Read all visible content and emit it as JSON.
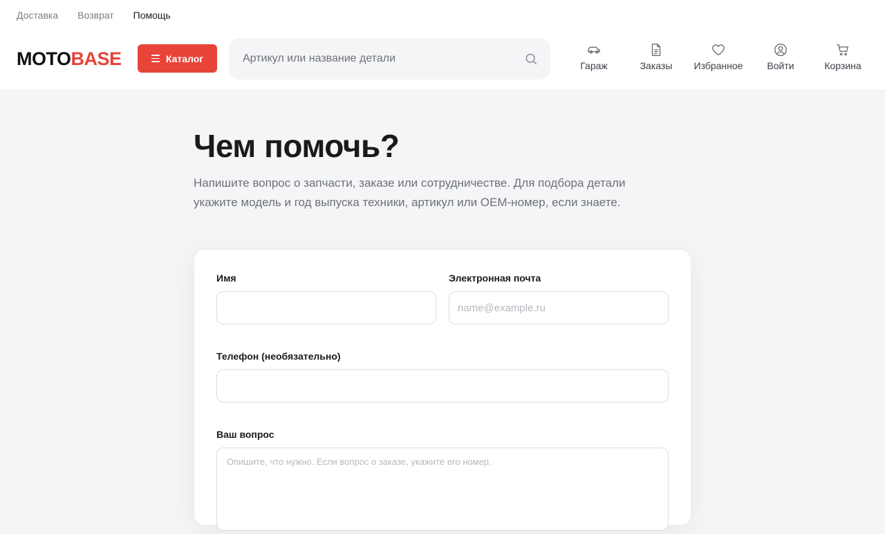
{
  "topnav": {
    "items": [
      {
        "label": "Доставка"
      },
      {
        "label": "Возврат"
      },
      {
        "label": "Помощь"
      }
    ]
  },
  "logo": {
    "part1": "MOTO",
    "part2": "BASE"
  },
  "catalog": {
    "label": "Каталог"
  },
  "search": {
    "placeholder": "Артикул или название детали"
  },
  "iconnav": [
    {
      "label": "Гараж",
      "icon": "car-icon"
    },
    {
      "label": "Заказы",
      "icon": "document-icon"
    },
    {
      "label": "Избранное",
      "icon": "heart-icon"
    },
    {
      "label": "Войти",
      "icon": "user-icon"
    },
    {
      "label": "Корзина",
      "icon": "cart-icon"
    }
  ],
  "page": {
    "title": "Чем помочь?",
    "intro": "Напишите вопрос о запчасти, заказе или сотрудничестве. Для подбора детали укажите модель и год выпуска техники, артикул или OEM-номер, если знаете."
  },
  "form": {
    "name": {
      "label": "Имя",
      "value": ""
    },
    "email": {
      "label": "Электронная почта",
      "placeholder": "name@example.ru"
    },
    "phone": {
      "label": "Телефон (необязательно)",
      "value": ""
    },
    "question": {
      "label": "Ваш вопрос",
      "placeholder": "Опишите, что нужно. Если вопрос о заказе, укажите его номер."
    }
  },
  "colors": {
    "accent": "#e8443a",
    "text": "#1a1a1a",
    "muted": "#6e7079",
    "background": "#f4f5f7"
  }
}
